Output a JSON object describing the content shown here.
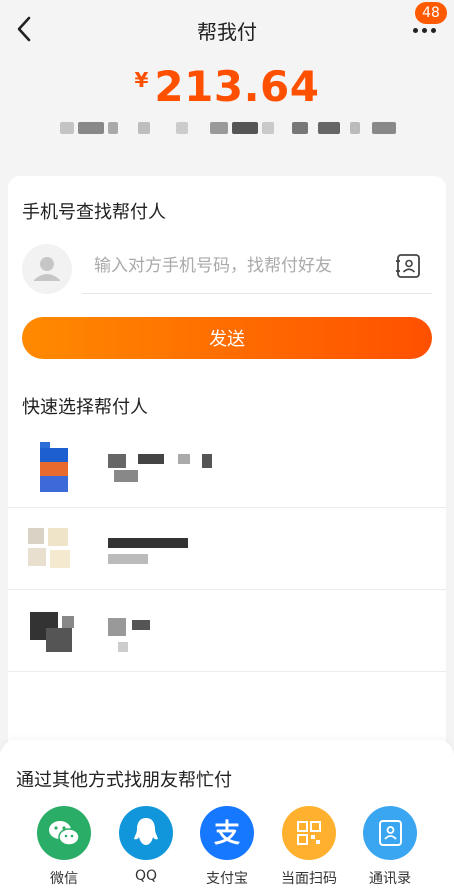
{
  "header": {
    "title": "帮我付",
    "back_icon": "chevron-left-icon",
    "more_icon": "more-dots-icon",
    "badge_count": "48"
  },
  "payment": {
    "currency": "¥",
    "amount": "213.64"
  },
  "phone_search": {
    "title": "手机号查找帮付人",
    "placeholder": "输入对方手机号码，找帮付好友",
    "send_label": "发送"
  },
  "quick_select": {
    "title": "快速选择帮付人"
  },
  "share": {
    "title": "通过其他方式找朋友帮忙付",
    "items": [
      {
        "label": "微信",
        "icon": "wechat-icon",
        "color": "#2aae67"
      },
      {
        "label": "QQ",
        "icon": "qq-icon",
        "color": "#1296db"
      },
      {
        "label": "支付宝",
        "icon": "alipay-icon",
        "color": "#1677ff"
      },
      {
        "label": "当面扫码",
        "icon": "qr-scan-icon",
        "color": "#ffb02e"
      },
      {
        "label": "通讯录",
        "icon": "contacts-icon",
        "color": "#3aa6f2"
      }
    ]
  },
  "colors": {
    "accent": "#ff5000",
    "badge": "#ff5a00"
  }
}
